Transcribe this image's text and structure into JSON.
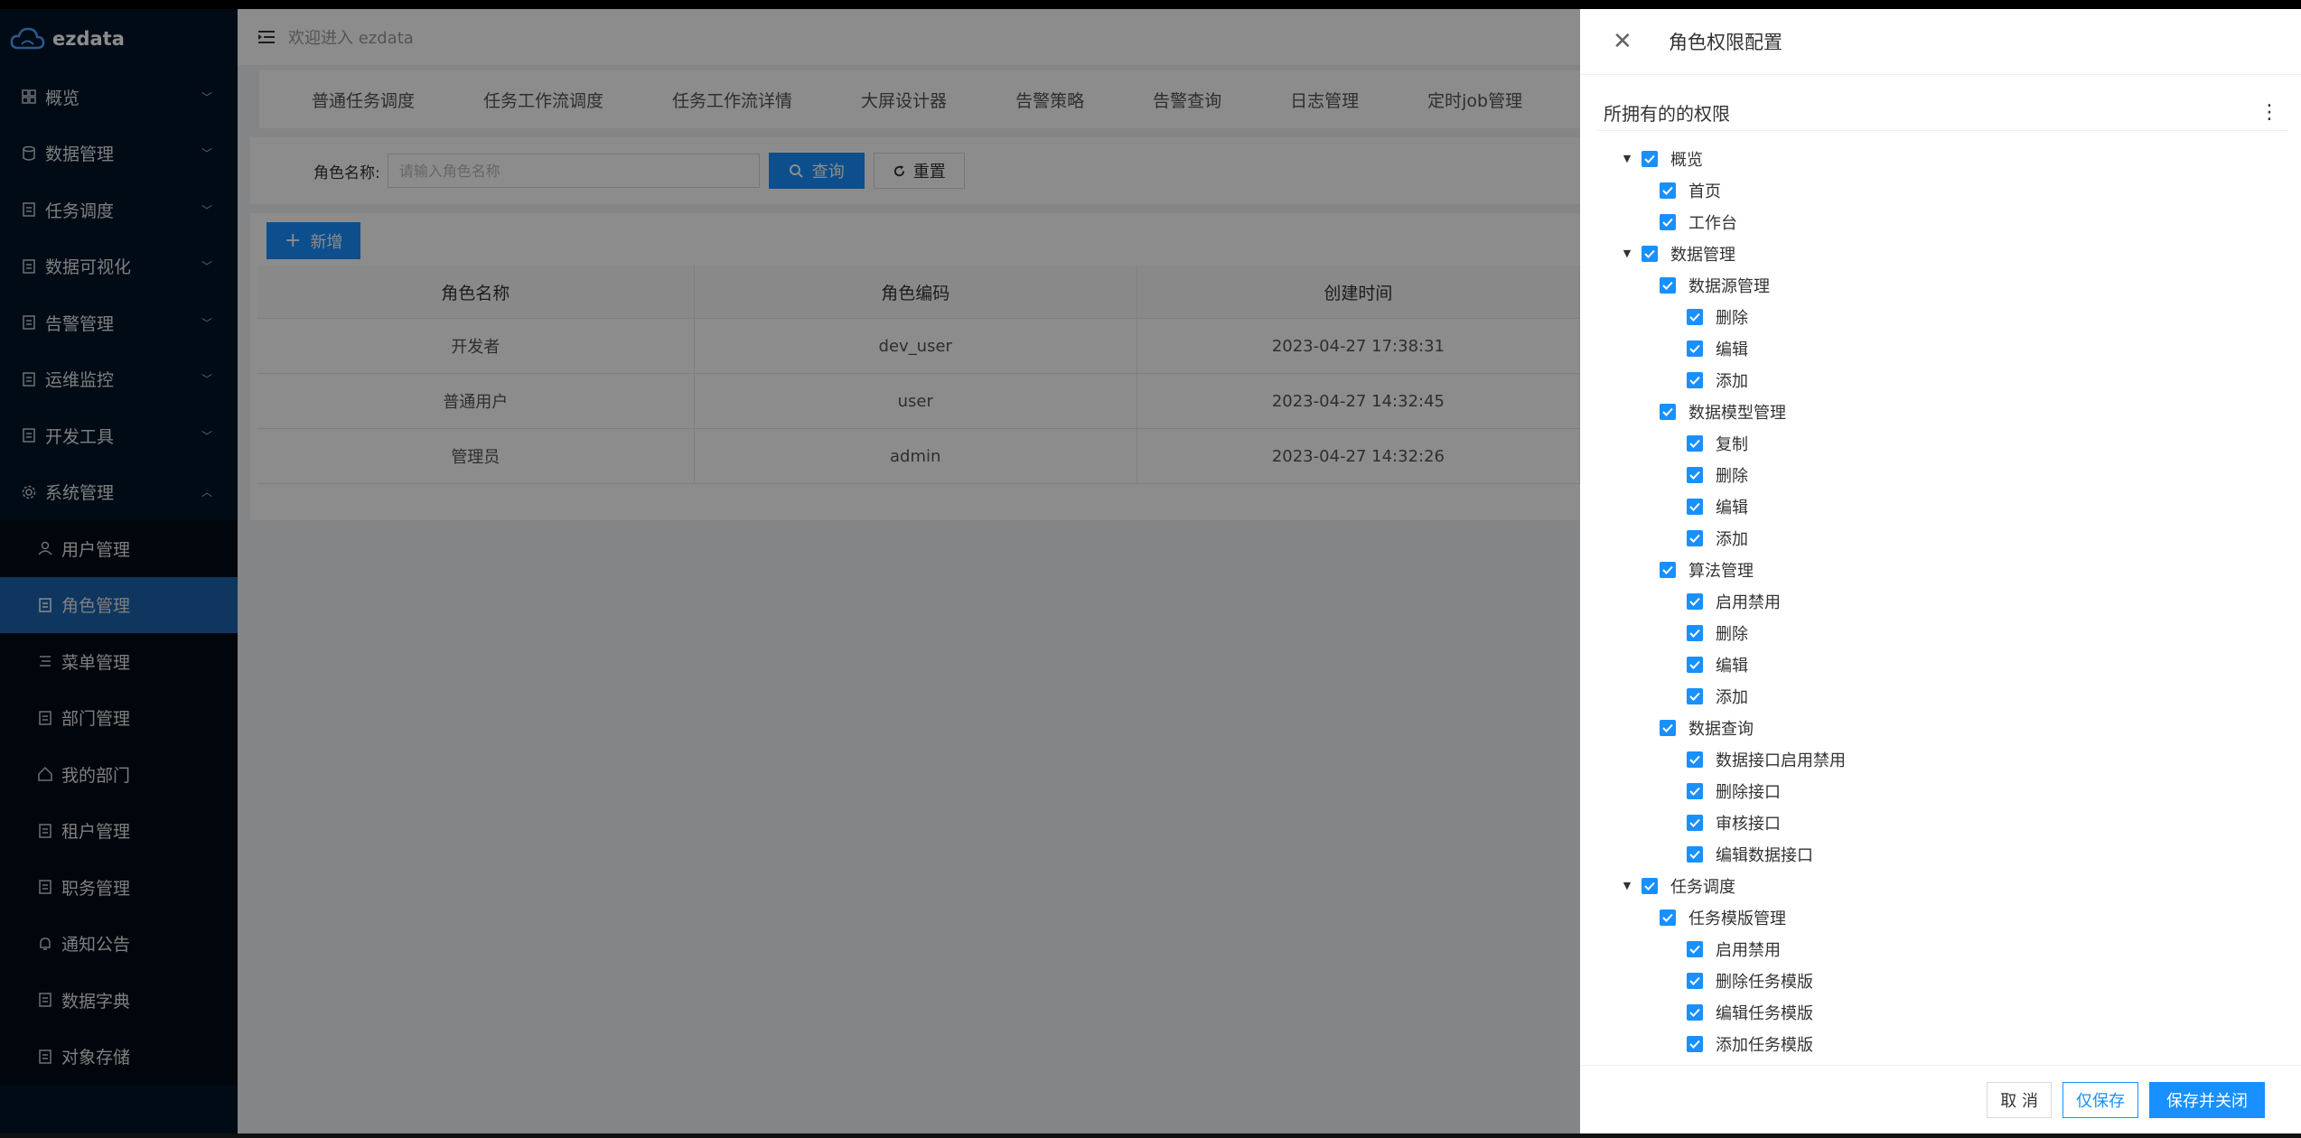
{
  "app": {
    "name": "ezdata",
    "welcome": "欢迎进入 ezdata"
  },
  "sidebar": {
    "items": [
      {
        "label": "概览",
        "icon": "dashboard-icon"
      },
      {
        "label": "数据管理",
        "icon": "database-icon"
      },
      {
        "label": "任务调度",
        "icon": "schedule-icon"
      },
      {
        "label": "数据可视化",
        "icon": "chart-icon"
      },
      {
        "label": "告警管理",
        "icon": "alert-icon"
      },
      {
        "label": "运维监控",
        "icon": "monitor-icon"
      },
      {
        "label": "开发工具",
        "icon": "code-icon"
      },
      {
        "label": "系统管理",
        "icon": "gear-icon"
      }
    ],
    "sub_items": [
      {
        "label": "用户管理",
        "icon": "user-icon"
      },
      {
        "label": "角色管理",
        "icon": "role-icon",
        "active": true
      },
      {
        "label": "菜单管理",
        "icon": "menu-icon"
      },
      {
        "label": "部门管理",
        "icon": "team-icon"
      },
      {
        "label": "我的部门",
        "icon": "home-icon"
      },
      {
        "label": "租户管理",
        "icon": "tenant-icon"
      },
      {
        "label": "职务管理",
        "icon": "post-icon"
      },
      {
        "label": "通知公告",
        "icon": "bell-icon"
      },
      {
        "label": "数据字典",
        "icon": "dict-icon"
      },
      {
        "label": "对象存储",
        "icon": "file-icon"
      }
    ]
  },
  "tabs": [
    "普通任务调度",
    "任务工作流调度",
    "任务工作流详情",
    "大屏设计器",
    "告警策略",
    "告警查询",
    "日志管理",
    "定时job管理"
  ],
  "search": {
    "label": "角色名称:",
    "placeholder": "请输入角色名称",
    "query_label": "查询",
    "reset_label": "重置"
  },
  "table": {
    "add_label": "新增",
    "columns": [
      "角色名称",
      "角色编码",
      "创建时间"
    ],
    "rows": [
      [
        "开发者",
        "dev_user",
        "2023-04-27 17:38:31"
      ],
      [
        "普通用户",
        "user",
        "2023-04-27 14:32:45"
      ],
      [
        "管理员",
        "admin",
        "2023-04-27 14:32:26"
      ]
    ]
  },
  "drawer": {
    "title": "角色权限配置",
    "perm_title": "所拥有的的权限",
    "tree": [
      {
        "level": 0,
        "label": "概览",
        "expanded": true
      },
      {
        "level": 1,
        "label": "首页"
      },
      {
        "level": 1,
        "label": "工作台"
      },
      {
        "level": 0,
        "label": "数据管理",
        "expanded": true
      },
      {
        "level": 1,
        "label": "数据源管理"
      },
      {
        "level": 2,
        "label": "删除"
      },
      {
        "level": 2,
        "label": "编辑"
      },
      {
        "level": 2,
        "label": "添加"
      },
      {
        "level": 1,
        "label": "数据模型管理"
      },
      {
        "level": 2,
        "label": "复制"
      },
      {
        "level": 2,
        "label": "删除"
      },
      {
        "level": 2,
        "label": "编辑"
      },
      {
        "level": 2,
        "label": "添加"
      },
      {
        "level": 1,
        "label": "算法管理"
      },
      {
        "level": 2,
        "label": "启用禁用"
      },
      {
        "level": 2,
        "label": "删除"
      },
      {
        "level": 2,
        "label": "编辑"
      },
      {
        "level": 2,
        "label": "添加"
      },
      {
        "level": 1,
        "label": "数据查询"
      },
      {
        "level": 2,
        "label": "数据接口启用禁用"
      },
      {
        "level": 2,
        "label": "删除接口"
      },
      {
        "level": 2,
        "label": "审核接口"
      },
      {
        "level": 2,
        "label": "编辑数据接口"
      },
      {
        "level": 0,
        "label": "任务调度",
        "expanded": true
      },
      {
        "level": 1,
        "label": "任务模版管理"
      },
      {
        "level": 2,
        "label": "启用禁用"
      },
      {
        "level": 2,
        "label": "删除任务模版"
      },
      {
        "level": 2,
        "label": "编辑任务模版"
      },
      {
        "level": 2,
        "label": "添加任务模版"
      }
    ],
    "buttons": {
      "cancel": "取 消",
      "save": "仅保存",
      "save_close": "保存并关闭"
    }
  },
  "colors": {
    "primary": "#1890ff",
    "sidebar_bg": "#001529",
    "sidebar_active": "#1c63ae"
  }
}
